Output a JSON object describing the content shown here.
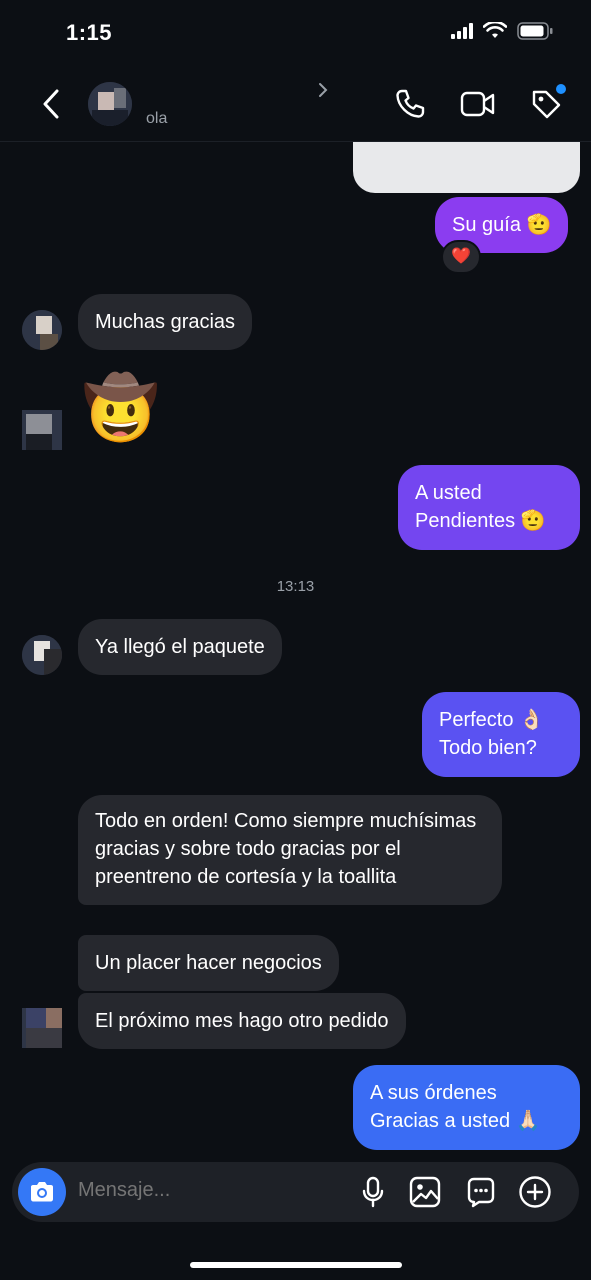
{
  "status": {
    "time": "1:15"
  },
  "header": {
    "name": "",
    "subtitle": "ola"
  },
  "messages": {
    "m1": "Su guía 🫡",
    "m1_reaction": "❤️",
    "m2": "Muchas gracias",
    "m3": "🤠",
    "m4_line1": "A usted",
    "m4_line2": "Pendientes 🫡",
    "time": "13:13",
    "m5": "Ya llegó el paquete",
    "m6_line1": "Perfecto 👌🏻",
    "m6_line2": "Todo bien?",
    "m7": "Todo en orden! Como siempre muchísimas gracias y sobre todo gracias por el preentreno de cortesía y la toallita",
    "m8": "Un placer hacer negocios",
    "m9": "El próximo mes hago otro pedido",
    "m10_line1": "A sus órdenes",
    "m10_line2": "Gracias a usted 🙏🏻"
  },
  "composer": {
    "placeholder": "Mensaje..."
  },
  "colors": {
    "background": "#0c0f14",
    "incoming": "#26282e",
    "outgoing_purple": "#8b3df0",
    "outgoing_violet": "#7446f0",
    "outgoing_indigo": "#5a52f2",
    "outgoing_blue": "#3a6cf4",
    "camera": "#3478f6"
  },
  "icons": [
    "back-chevron-icon",
    "phone-icon",
    "video-icon",
    "tag-icon",
    "camera-icon",
    "microphone-icon",
    "gallery-icon",
    "sticker-icon",
    "plus-icon"
  ]
}
